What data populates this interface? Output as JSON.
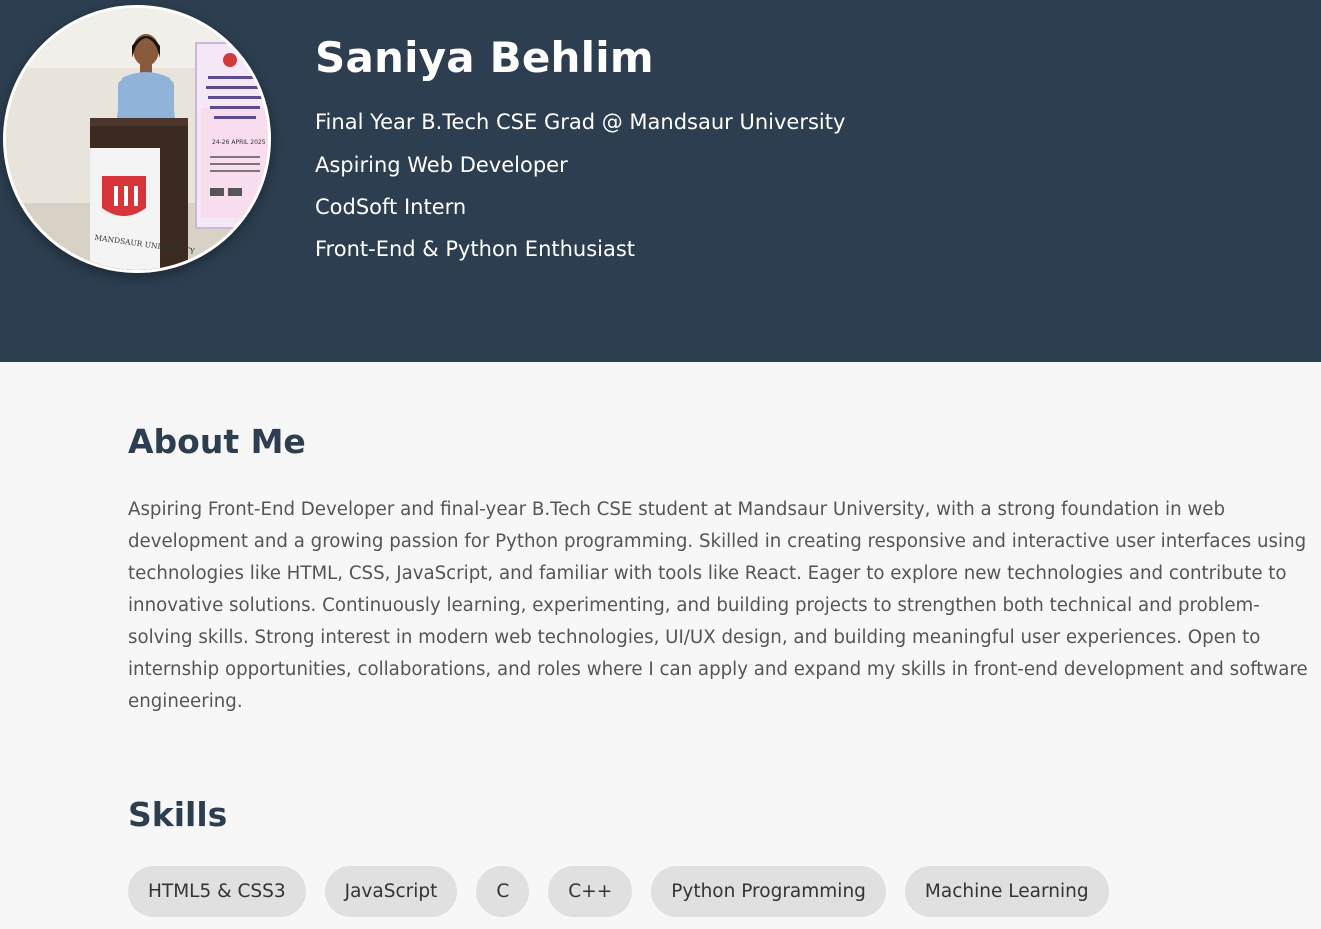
{
  "header": {
    "name": "Saniya Behlim",
    "taglines": [
      "Final Year B.Tech CSE Grad @ Mandsaur University",
      "Aspiring Web Developer",
      "CodSoft Intern",
      "Front-End & Python Enthusiast"
    ],
    "photo_banner_text": "MANDSAUR UNIVERSITY",
    "photo_poster_date": "24-26 APRIL 2025"
  },
  "about": {
    "title": "About Me",
    "text": "Aspiring Front-End Developer and final-year B.Tech CSE student at Mandsaur University, with a strong foundation in web development and a growing passion for Python programming. Skilled in creating responsive and interactive user interfaces using technologies like HTML, CSS, JavaScript, and familiar with tools like React. Eager to explore new technologies and contribute to innovative solutions. Continuously learning, experimenting, and building projects to strengthen both technical and problem-solving skills. Strong interest in modern web technologies, UI/UX design, and building meaningful user experiences. Open to internship opportunities, collaborations, and roles where I can apply and expand my skills in front-end development and software engineering."
  },
  "skills": {
    "title": "Skills",
    "items": [
      "HTML5 & CSS3",
      "JavaScript",
      "C",
      "C++",
      "Python Programming",
      "Machine Learning"
    ]
  },
  "colors": {
    "header_bg": "#2c3e50",
    "page_bg": "#f7f7f7",
    "heading": "#2c3e50",
    "body_text": "#555555",
    "skill_bg": "#e0e0e0"
  }
}
